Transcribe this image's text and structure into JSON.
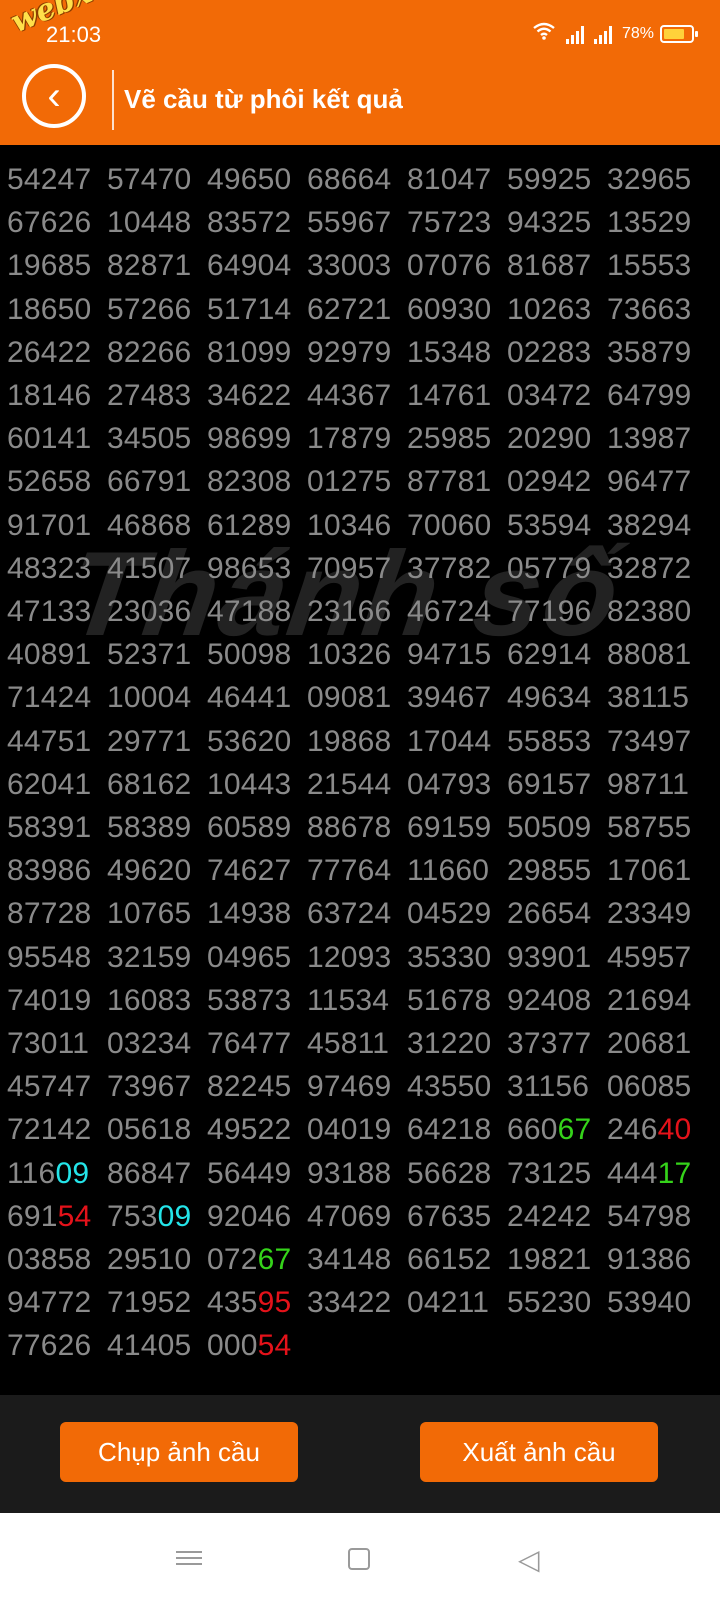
{
  "status": {
    "time": "21:03",
    "battery": "78%",
    "battery_level": 0.78
  },
  "watermark": "webxoso.net",
  "header": {
    "title": "Vẽ cầu từ phôi kết quả"
  },
  "grid_watermark": "Thánh số",
  "rows": [
    [
      "54247",
      "57470",
      "49650",
      "68664",
      "81047",
      "59925",
      "32965"
    ],
    [
      "67626",
      "10448",
      "83572",
      "55967",
      "75723",
      "94325",
      "13529"
    ],
    [
      "19685",
      "82871",
      "64904",
      "33003",
      "07076",
      "81687",
      "15553"
    ],
    [
      "18650",
      "57266",
      "51714",
      "62721",
      "60930",
      "10263",
      "73663"
    ],
    [
      "26422",
      "82266",
      "81099",
      "92979",
      "15348",
      "02283",
      "35879"
    ],
    [
      "18146",
      "27483",
      "34622",
      "44367",
      "14761",
      "03472",
      "64799"
    ],
    [
      "60141",
      "34505",
      "98699",
      "17879",
      "25985",
      "20290",
      "13987"
    ],
    [
      "52658",
      "66791",
      "82308",
      "01275",
      "87781",
      "02942",
      "96477"
    ],
    [
      "91701",
      "46868",
      "61289",
      "10346",
      "70060",
      "53594",
      "38294"
    ],
    [
      "48323",
      "41507",
      "98653",
      "70957",
      "37782",
      "05779",
      "32872"
    ],
    [
      "47133",
      "23036",
      "47188",
      "23166",
      "46724",
      "77196",
      "82380"
    ],
    [
      "40891",
      "52371",
      "50098",
      "10326",
      "94715",
      "62914",
      "88081"
    ],
    [
      "71424",
      "10004",
      "46441",
      "09081",
      "39467",
      "49634",
      "38115"
    ],
    [
      "44751",
      "29771",
      "53620",
      "19868",
      "17044",
      "55853",
      "73497"
    ],
    [
      "62041",
      "68162",
      "10443",
      "21544",
      "04793",
      "69157",
      "98711"
    ],
    [
      "58391",
      "58389",
      "60589",
      "88678",
      "69159",
      "50509",
      "58755"
    ],
    [
      "83986",
      "49620",
      "74627",
      "77764",
      "11660",
      "29855",
      "17061"
    ],
    [
      "87728",
      "10765",
      "14938",
      "63724",
      "04529",
      "26654",
      "23349"
    ],
    [
      "95548",
      "32159",
      "04965",
      "12093",
      "35330",
      "93901",
      "45957"
    ],
    [
      "74019",
      "16083",
      "53873",
      "11534",
      "51678",
      "92408",
      "21694"
    ],
    [
      "73011",
      "03234",
      "76477",
      "45811",
      "31220",
      "37377",
      "20681"
    ],
    [
      "45747",
      "73967",
      "82245",
      "97469",
      "43550",
      "31156",
      "06085"
    ],
    [
      "72142",
      "05618",
      "49522",
      "04019",
      "64218",
      [
        "660",
        "67",
        "green"
      ],
      [
        "246",
        "40",
        "red"
      ]
    ],
    [
      [
        "116",
        "09",
        "cyan"
      ],
      "86847",
      "56449",
      "93188",
      "56628",
      "73125",
      [
        "444",
        "17",
        "green"
      ]
    ],
    [
      [
        "691",
        "54",
        "red"
      ],
      [
        "753",
        "09",
        "cyan"
      ],
      "92046",
      "47069",
      "67635",
      "24242",
      "54798"
    ],
    [
      "03858",
      "29510",
      [
        "072",
        "67",
        "green"
      ],
      "34148",
      "66152",
      "19821",
      "91386"
    ],
    [
      "94772",
      "71952",
      [
        "435",
        "95",
        "red"
      ],
      "33422",
      "04211",
      "55230",
      "53940"
    ],
    [
      "77626",
      "41405",
      [
        "000",
        "54",
        "red"
      ]
    ]
  ],
  "buttons": {
    "capture": "Chụp ảnh cầu",
    "export": "Xuất ảnh cầu"
  },
  "nav": {
    "menu_icon": "menu-icon",
    "home_icon": "square-home-icon",
    "back_icon": "triangle-back-icon"
  },
  "colors": {
    "accent": "#f26a06",
    "text_gray": "#8a8a8a",
    "highlight_green": "#35d31a",
    "highlight_red": "#e4121a",
    "highlight_cyan": "#24e4e9"
  }
}
